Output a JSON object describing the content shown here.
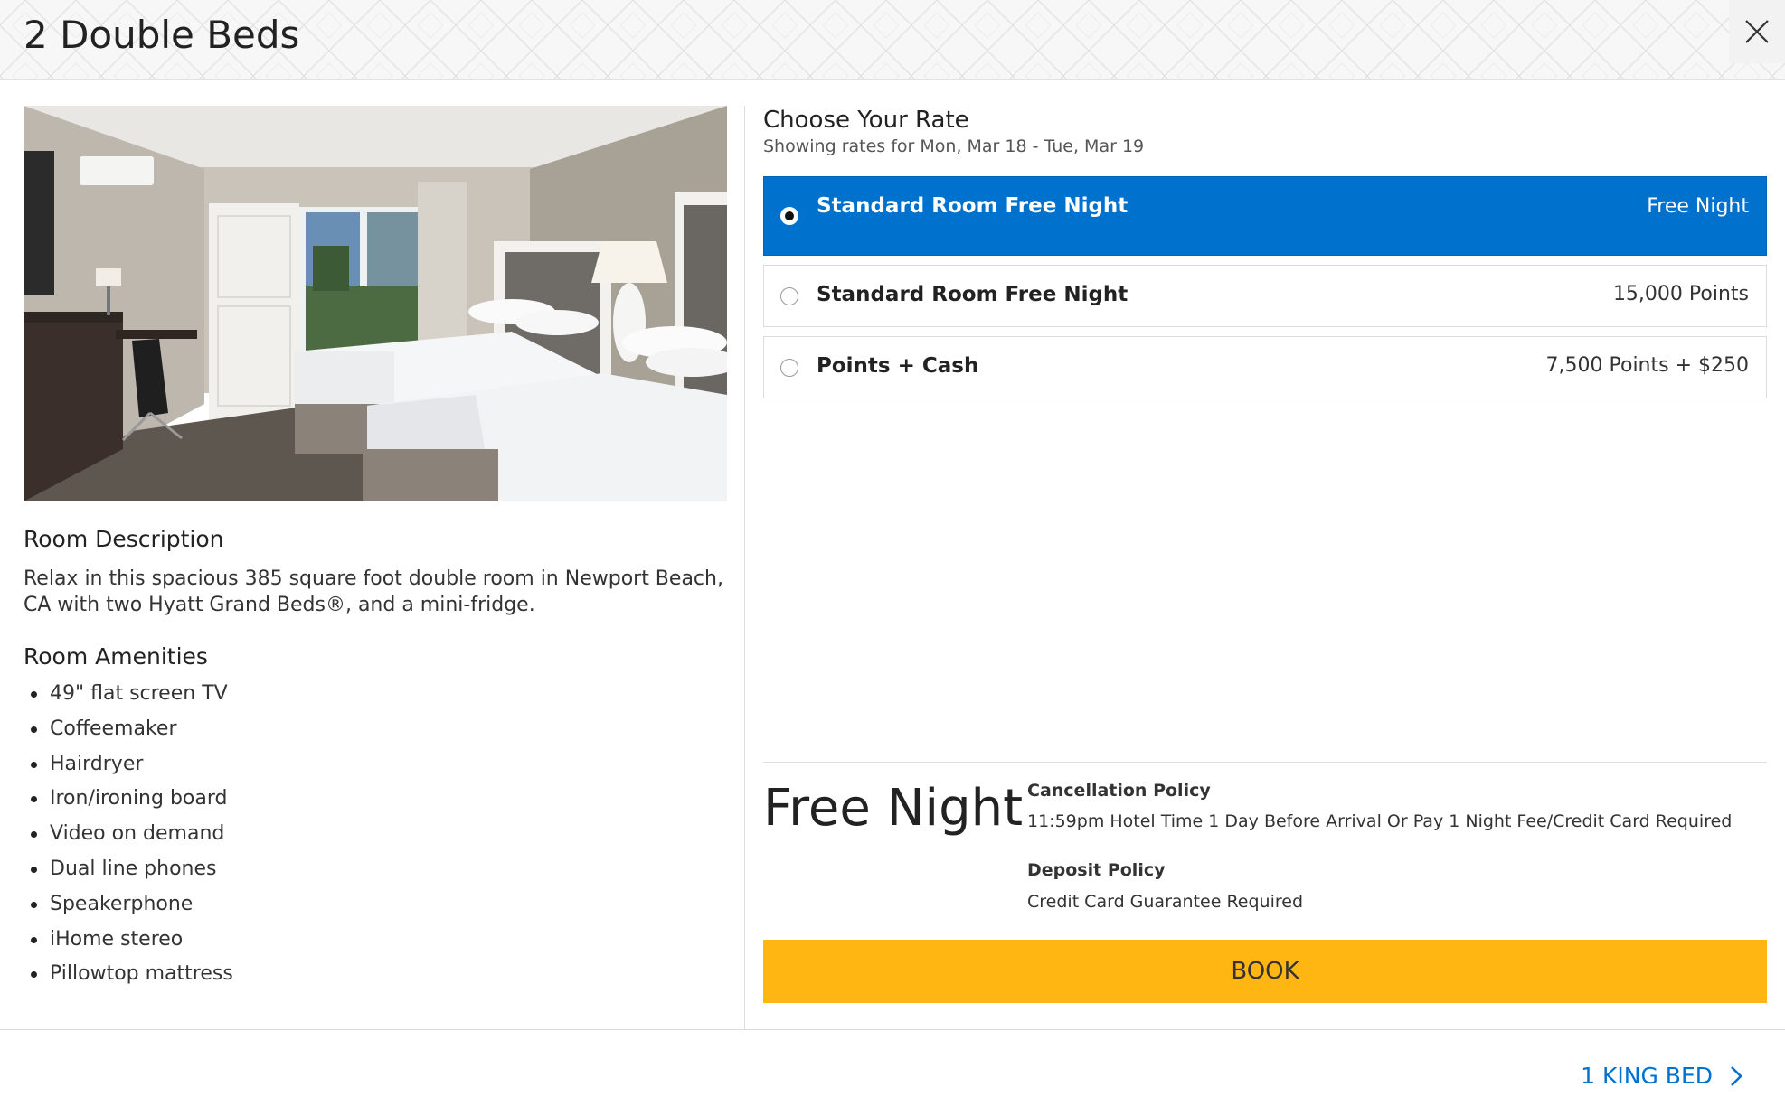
{
  "header": {
    "title": "2 Double Beds",
    "close_icon": "close-icon"
  },
  "room": {
    "photo_alt": "",
    "description_heading": "Room Description",
    "description_text": "Relax in this spacious 385 square foot double room in Newport Beach, CA with two Hyatt Grand Beds®, and a mini-fridge.",
    "amenities_heading": "Room Amenities",
    "amenities": [
      "49\" flat screen TV",
      "Coffeemaker",
      "Hairdryer",
      "Iron/ironing board",
      "Video on demand",
      "Dual line phones",
      "Speakerphone",
      "iHome stereo",
      "Pillowtop mattress"
    ]
  },
  "rates": {
    "heading": "Choose Your Rate",
    "subheading": "Showing rates for Mon, Mar 18 - Tue, Mar 19",
    "options": [
      {
        "name": "Standard Room Free Night",
        "price": "Free Night",
        "selected": true
      },
      {
        "name": "Standard Room Free Night",
        "price": "15,000 Points",
        "selected": false
      },
      {
        "name": "Points + Cash",
        "price": "7,500 Points + $250",
        "selected": false
      }
    ]
  },
  "summary": {
    "price": "Free Night",
    "cancellation_title": "Cancellation Policy",
    "cancellation_text": "11:59pm Hotel Time 1 Day Before Arrival Or Pay 1 Night Fee/Credit Card Required",
    "deposit_title": "Deposit Policy",
    "deposit_text": "Credit Card Guarantee Required",
    "book_label": "BOOK"
  },
  "footer": {
    "next_label": "1 KING BED",
    "next_icon": "chevron-right-icon"
  },
  "colors": {
    "accent_blue": "#0072ce",
    "book_yellow": "#ffb612"
  }
}
